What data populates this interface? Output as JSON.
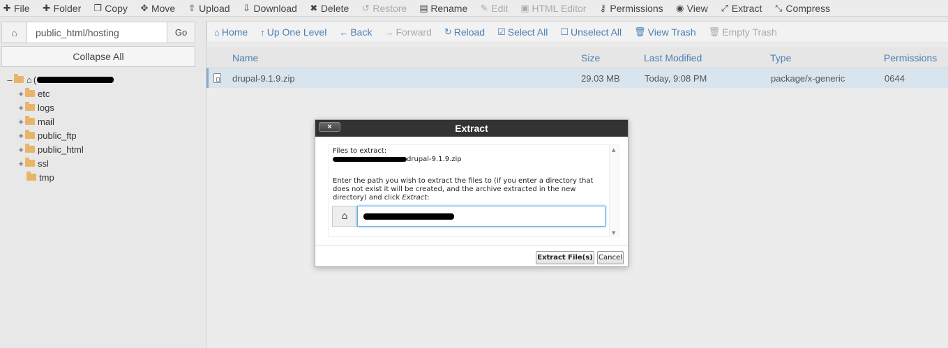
{
  "toolbar": {
    "items": [
      {
        "label": "File",
        "icon": "plus-icon",
        "enabled": true
      },
      {
        "label": "Folder",
        "icon": "plus-icon",
        "enabled": true
      },
      {
        "label": "Copy",
        "icon": "copy-icon",
        "enabled": true
      },
      {
        "label": "Move",
        "icon": "move-icon",
        "enabled": true
      },
      {
        "label": "Upload",
        "icon": "upload-icon",
        "enabled": true
      },
      {
        "label": "Download",
        "icon": "download-icon",
        "enabled": true
      },
      {
        "label": "Delete",
        "icon": "delete-icon",
        "enabled": true
      },
      {
        "label": "Restore",
        "icon": "restore-icon",
        "enabled": false
      },
      {
        "label": "Rename",
        "icon": "rename-icon",
        "enabled": true
      },
      {
        "label": "Edit",
        "icon": "pencil-icon",
        "enabled": false
      },
      {
        "label": "HTML Editor",
        "icon": "html-editor-icon",
        "enabled": false
      },
      {
        "label": "Permissions",
        "icon": "key-icon",
        "enabled": true
      },
      {
        "label": "View",
        "icon": "eye-icon",
        "enabled": true
      },
      {
        "label": "Extract",
        "icon": "extract-icon",
        "enabled": true
      },
      {
        "label": "Compress",
        "icon": "compress-icon",
        "enabled": true
      }
    ]
  },
  "left": {
    "path_value": "public_html/hosting",
    "go_label": "Go",
    "collapse_label": "Collapse All",
    "tree": {
      "root_prefix": "(",
      "items": [
        "etc",
        "logs",
        "mail",
        "public_ftp",
        "public_html",
        "ssl",
        "tmp"
      ]
    }
  },
  "nav": {
    "items": [
      {
        "label": "Home",
        "icon": "home-icon",
        "enabled": true
      },
      {
        "label": "Up One Level",
        "icon": "level-up-icon",
        "enabled": true
      },
      {
        "label": "Back",
        "icon": "arrow-left-icon",
        "enabled": true
      },
      {
        "label": "Forward",
        "icon": "arrow-right-icon",
        "enabled": false
      },
      {
        "label": "Reload",
        "icon": "reload-icon",
        "enabled": true
      },
      {
        "label": "Select All",
        "icon": "checkbox-checked-icon",
        "enabled": true
      },
      {
        "label": "Unselect All",
        "icon": "checkbox-empty-icon",
        "enabled": true
      },
      {
        "label": "View Trash",
        "icon": "trash-icon",
        "enabled": true
      },
      {
        "label": "Empty Trash",
        "icon": "trash-icon",
        "enabled": false
      }
    ]
  },
  "table": {
    "headers": {
      "name": "Name",
      "size": "Size",
      "modified": "Last Modified",
      "type": "Type",
      "perms": "Permissions"
    },
    "rows": [
      {
        "name": "drupal-9.1.9.zip",
        "size": "29.03 MB",
        "modified": "Today, 9:08 PM",
        "type": "package/x-generic",
        "perms": "0644"
      }
    ]
  },
  "modal": {
    "title": "Extract",
    "close_label": "×",
    "files_label": "Files to extract:",
    "file_name": "drupal-9.1.9.zip",
    "instruction_pre": "Enter the path you wish to extract the files to (if you enter a directory that does not exist it will be created, and the archive extracted in the new directory) and click ",
    "instruction_em": "Extract",
    "instruction_post": ":",
    "extract_button": "Extract File(s)",
    "cancel_button": "Cancel"
  },
  "colors": {
    "link": "#4a7fb5",
    "selected_row": "#d9e5ee",
    "modal_header": "#333333",
    "folder": "#e8b46a"
  }
}
